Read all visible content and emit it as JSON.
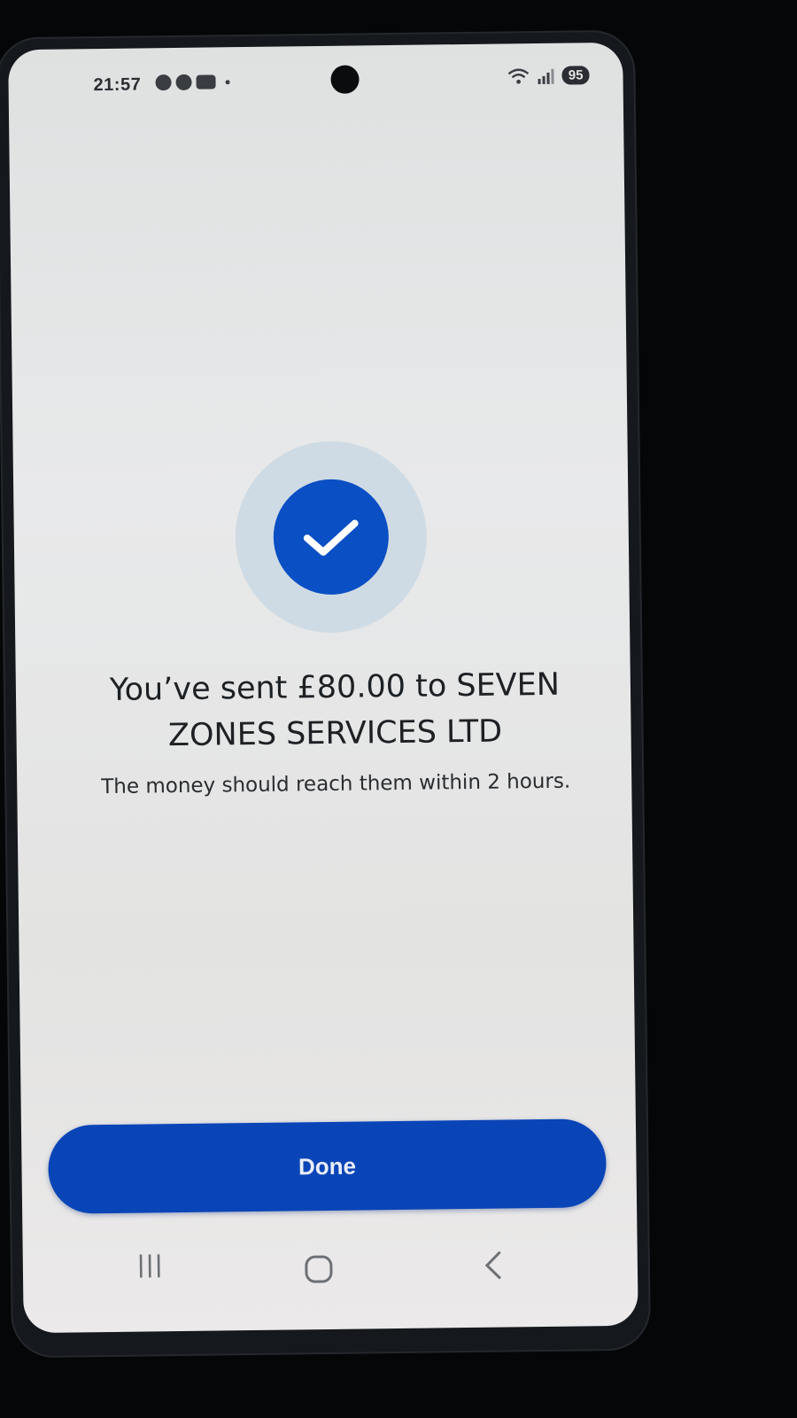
{
  "status_bar": {
    "time": "21:57",
    "battery": "95",
    "icons": [
      "settings-notification-icon",
      "app-notification-icon",
      "youtube-notification-icon",
      "dot-icon",
      "wifi-icon",
      "signal-icon",
      "battery-icon"
    ]
  },
  "confirmation": {
    "icon": "checkmark-icon",
    "title": "You’ve sent £80.00 to SEVEN ZONES SERVICES LTD",
    "subtitle": "The money should reach them within 2 hours."
  },
  "actions": {
    "done_label": "Done"
  },
  "navigation": {
    "items": [
      "recents-icon",
      "home-icon",
      "back-icon"
    ]
  },
  "colors": {
    "primary_blue": "#0a45b7",
    "check_circle": "#0a4fc4",
    "check_halo": "#cfdbe4",
    "screen_bg": "#e5e6e7"
  }
}
